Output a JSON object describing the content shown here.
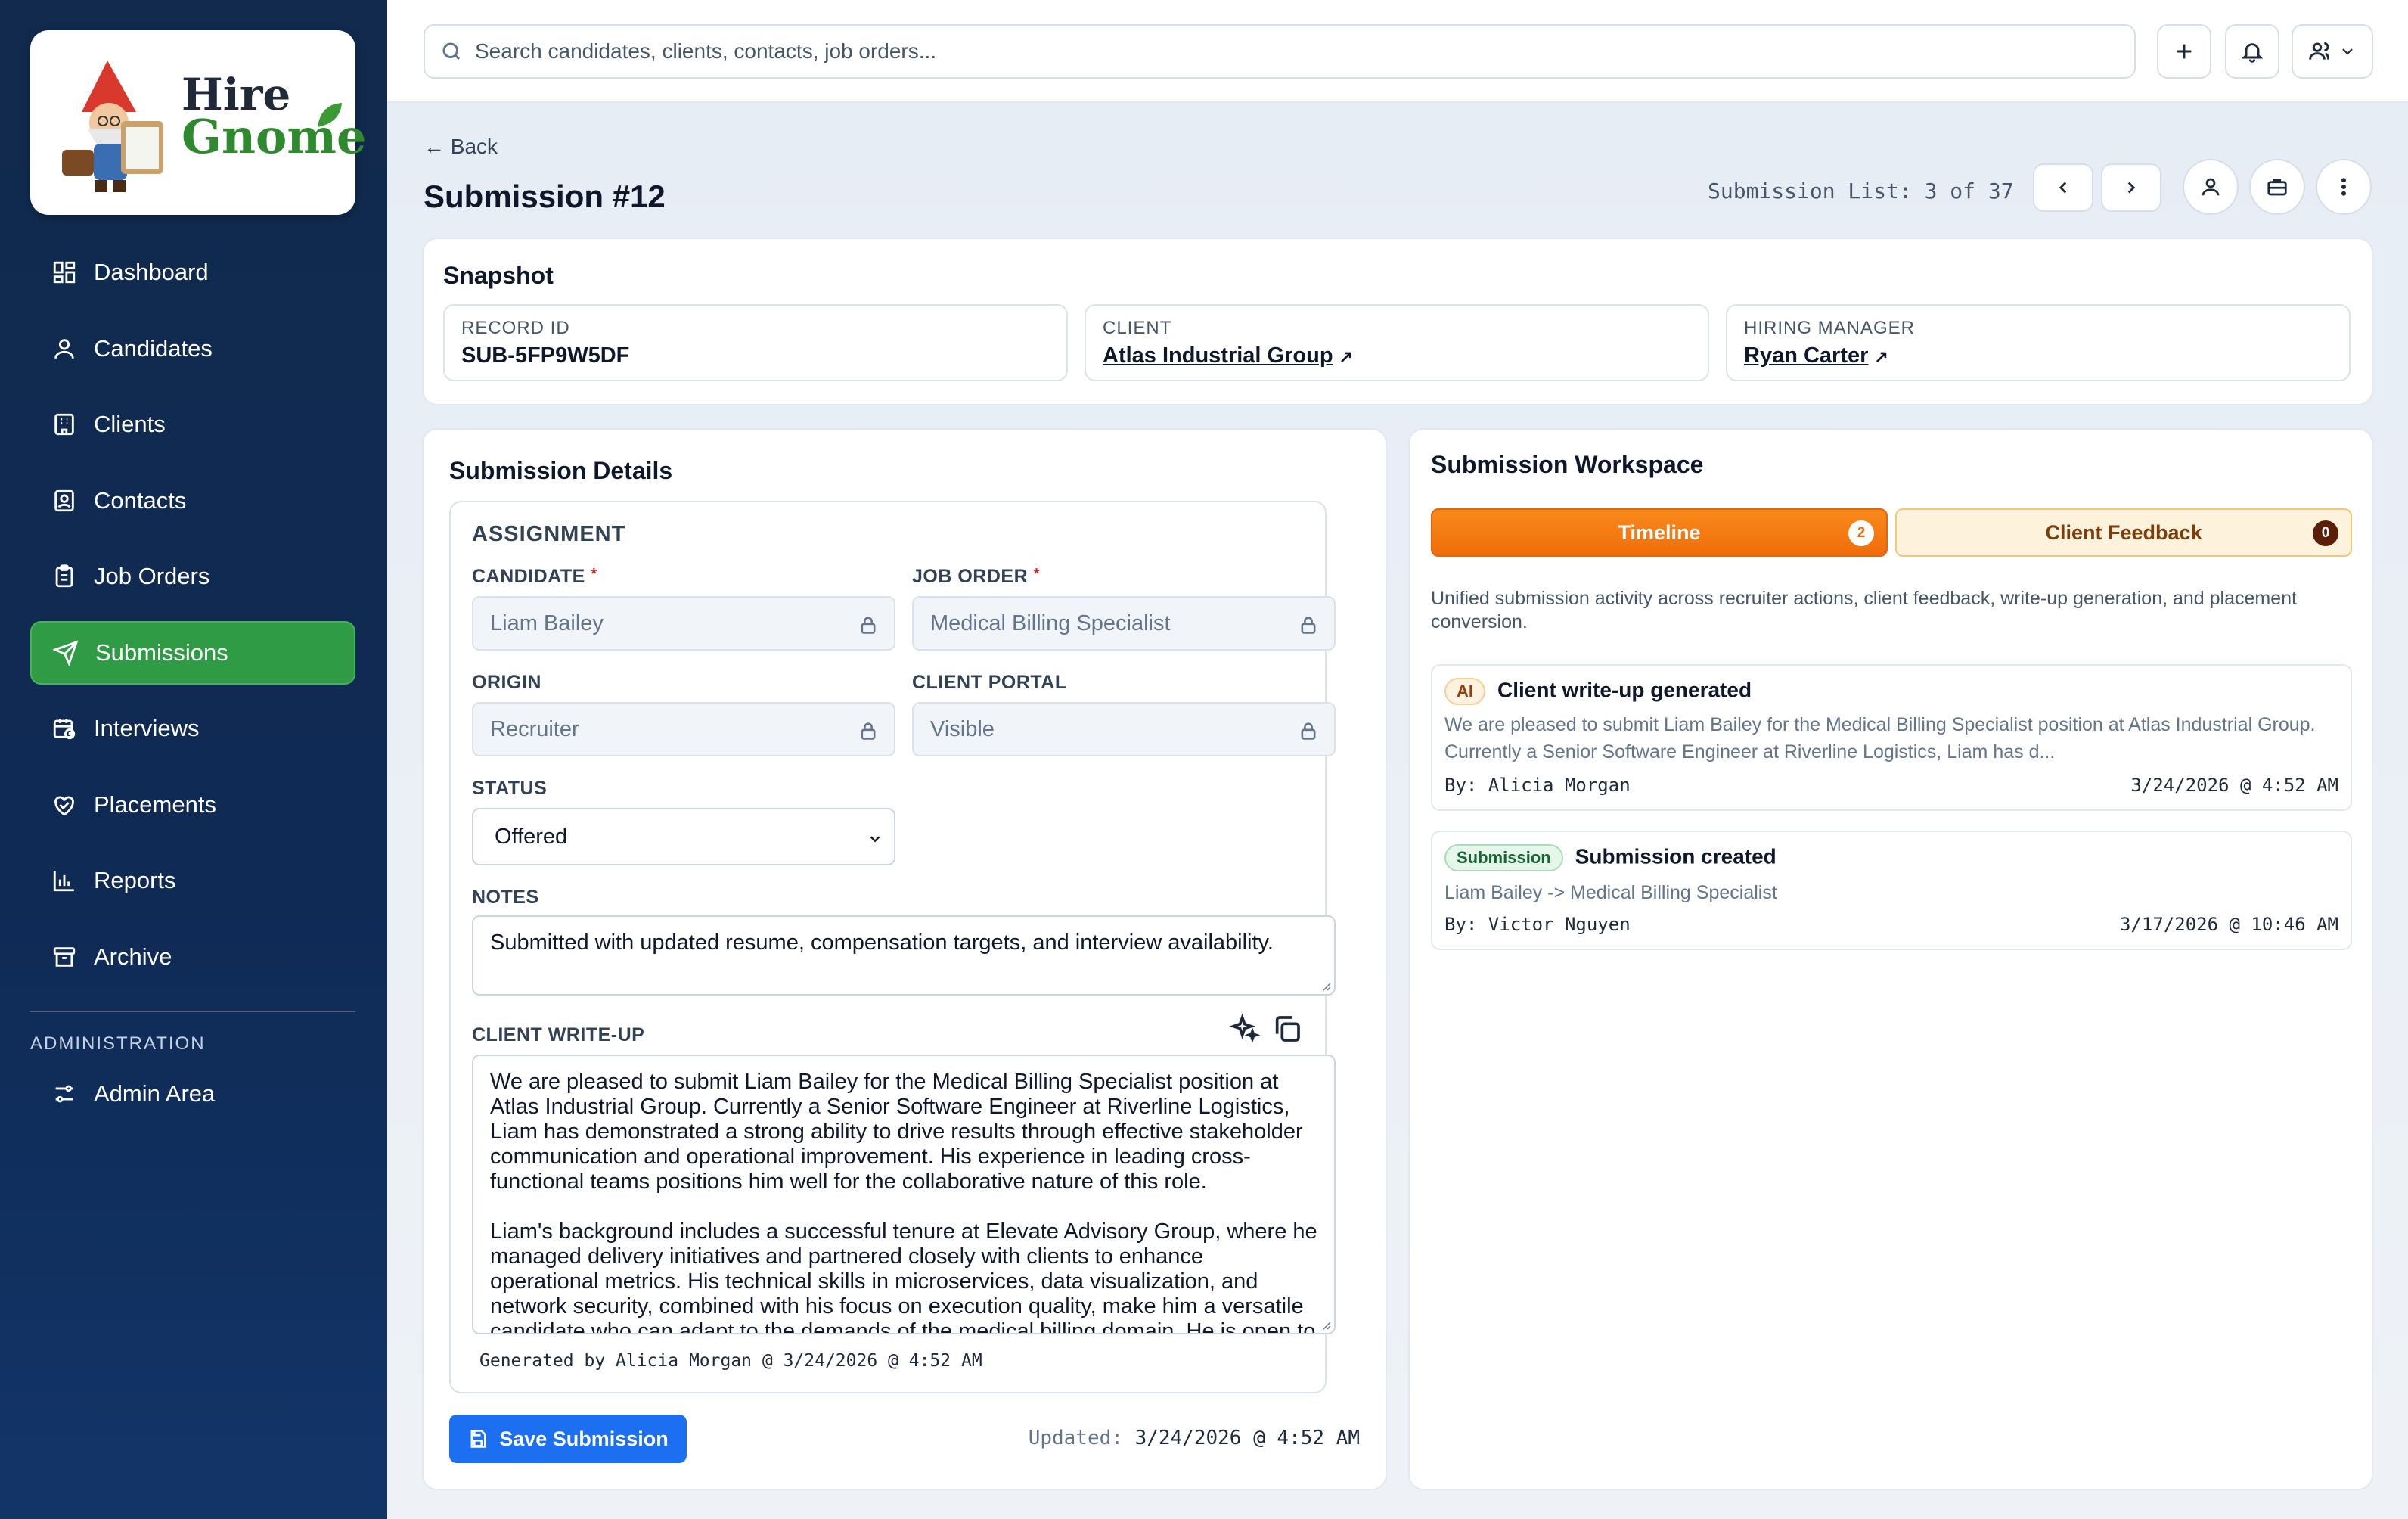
{
  "brand": {
    "line1": "Hire",
    "line2": "Gnome"
  },
  "sidebar": {
    "items": [
      {
        "label": "Dashboard",
        "icon": "dashboard-icon"
      },
      {
        "label": "Candidates",
        "icon": "user-icon"
      },
      {
        "label": "Clients",
        "icon": "building-icon"
      },
      {
        "label": "Contacts",
        "icon": "contact-card-icon"
      },
      {
        "label": "Job Orders",
        "icon": "clipboard-icon"
      },
      {
        "label": "Submissions",
        "icon": "send-icon",
        "active": true
      },
      {
        "label": "Interviews",
        "icon": "calendar-clock-icon"
      },
      {
        "label": "Placements",
        "icon": "handshake-icon"
      },
      {
        "label": "Reports",
        "icon": "bar-chart-icon"
      },
      {
        "label": "Archive",
        "icon": "archive-icon"
      }
    ],
    "admin_title": "ADMINISTRATION",
    "admin_item": "Admin Area"
  },
  "topbar": {
    "search_placeholder": "Search candidates, clients, contacts, job orders..."
  },
  "header": {
    "back": "← Back",
    "title": "Submission #12",
    "list_label": "Submission List:",
    "list_position": "3",
    "list_of": "of",
    "list_total": "37"
  },
  "snapshot": {
    "title": "Snapshot",
    "record_label": "RECORD ID",
    "record_value": "SUB-5FP9W5DF",
    "client_label": "CLIENT",
    "client_value": "Atlas Industrial Group",
    "manager_label": "HIRING MANAGER",
    "manager_value": "Ryan Carter",
    "ext_symbol": "↗"
  },
  "details": {
    "title": "Submission Details",
    "assignment": "ASSIGNMENT",
    "candidate_label": "CANDIDATE",
    "candidate_value": "Liam Bailey",
    "job_label": "JOB ORDER",
    "job_value": "Medical Billing Specialist",
    "required_mark": "*",
    "origin_label": "ORIGIN",
    "origin_value": "Recruiter",
    "portal_label": "CLIENT PORTAL",
    "portal_value": "Visible",
    "status_label": "STATUS",
    "status_value": "Offered",
    "notes_label": "NOTES",
    "notes_value": "Submitted with updated resume, compensation targets, and interview availability.",
    "writeup_label": "CLIENT WRITE-UP",
    "writeup_p1": "We are pleased to submit Liam Bailey for the Medical Billing Specialist position at Atlas Industrial Group. Currently a Senior Software Engineer at Riverline Logistics, Liam has demonstrated a strong ability to drive results through effective stakeholder communication and operational improvement. His experience in leading cross-functional teams positions him well for the collaborative nature of this role.",
    "writeup_p2": "Liam's background includes a successful tenure at Elevate Advisory Group, where he managed delivery initiatives and partnered closely with clients to enhance operational metrics. His technical skills in microservices, data visualization, and network security, combined with his focus on execution quality, make him a versatile candidate who can adapt to the demands of the medical billing domain. He is open to hybrid and remote",
    "generated_by": "Generated by Alicia Morgan @ 3/24/2026 @ 4:52 AM",
    "save_label": "Save Submission",
    "updated_label": "Updated:",
    "updated_value": "3/24/2026 @ 4:52 AM"
  },
  "workspace": {
    "title": "Submission Workspace",
    "tab_timeline": "Timeline",
    "tab_timeline_count": "2",
    "tab_feedback": "Client Feedback",
    "tab_feedback_count": "0",
    "description": "Unified submission activity across recruiter actions, client feedback, write-up generation, and placement conversion.",
    "events": [
      {
        "badge": "AI",
        "title": "Client write-up generated",
        "body": "We are pleased to submit Liam Bailey for the Medical Billing Specialist position at Atlas Industrial Group. Currently a Senior Software Engineer at Riverline Logistics, Liam has d...",
        "by": "By: Alicia Morgan",
        "date": "3/24/2026 @ 4:52 AM"
      },
      {
        "badge": "Submission",
        "title": "Submission created",
        "body": "Liam Bailey -> Medical Billing Specialist",
        "by": "By: Victor Nguyen",
        "date": "3/17/2026 @ 10:46 AM"
      }
    ]
  },
  "colors": {
    "accent_green": "#2f9c45",
    "primary_blue": "#1d6ff2",
    "timeline_orange": "#f07a12",
    "sidebar_navy": "#112a4d"
  }
}
